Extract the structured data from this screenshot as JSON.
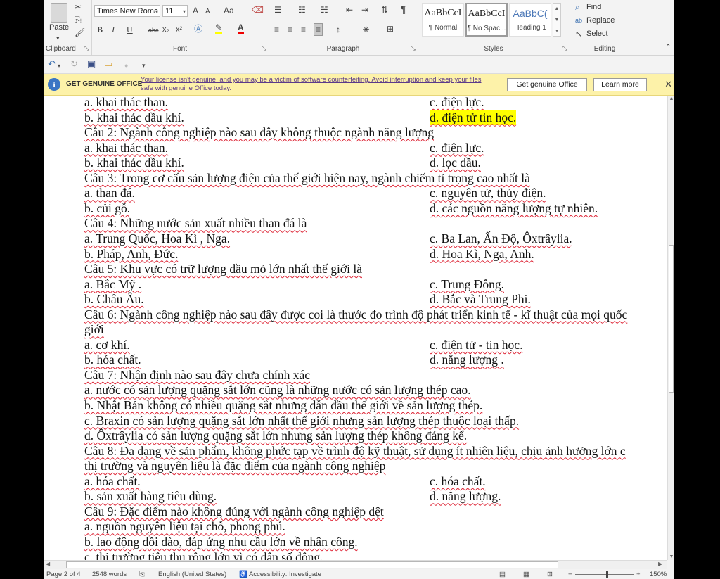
{
  "ribbon": {
    "clipboard": {
      "paste": "Paste",
      "label": "Clipboard"
    },
    "font": {
      "name": "Times New Roma",
      "size": "11",
      "label": "Font",
      "bold": "B",
      "italic": "I",
      "underline": "U",
      "strike": "abc",
      "subscript": "x₂",
      "superscript": "x²",
      "grow": "A",
      "shrink": "A",
      "change_case": "Aa"
    },
    "paragraph": {
      "label": "Paragraph"
    },
    "styles": {
      "label": "Styles",
      "items": [
        {
          "preview": "AaBbCcI",
          "name": "¶ Normal"
        },
        {
          "preview": "AaBbCcI",
          "name": "¶ No Spac..."
        },
        {
          "preview": "AaBbC(",
          "name": "Heading 1"
        }
      ]
    },
    "editing": {
      "find": "Find",
      "replace": "Replace",
      "select": "Select",
      "label": "Editing"
    }
  },
  "message_bar": {
    "title": "GET GENUINE OFFICE",
    "text": "Your license isn't genuine, and you may be a victim of software counterfeiting. Avoid interruption and keep your files safe with genuine Office today.",
    "get_button": "Get genuine Office",
    "learn_button": "Learn more"
  },
  "document": {
    "lines": [
      {
        "text": "a. khai thác than.",
        "ans": "c. điện lực."
      },
      {
        "text": "b. khai thác dầu khí.",
        "ans": "d. điện tử tin học."
      },
      {
        "text": "Câu 2: Ngành công nghiệp nào sau đây không thuộc ngành năng lượng",
        "ans": ""
      },
      {
        "text": "a. khai thác than.",
        "ans": "c. điện lực."
      },
      {
        "text": "b. khai thác dầu khí.",
        "ans": "d. lọc dầu."
      },
      {
        "text": "Câu 3: Trong cơ cấu sản lượng điện của thế giới hiện nay, ngành chiếm tỉ trọng cao nhất là",
        "ans": ""
      },
      {
        "text": "a. than đá.",
        "ans": "c. nguyên tử, thủy điện."
      },
      {
        "text": "b. củi gỗ.",
        "ans": "d. các nguồn năng lượng tự nhiên."
      },
      {
        "text": "Câu 4: Những nước sản xuất nhiều than đá là",
        "ans": ""
      },
      {
        "text": "a. Trung Quốc, Hoa Kì , Nga.",
        "ans": "c. Ba Lan, Ấn Độ, Ôxtrâylia."
      },
      {
        "text": "b. Pháp, Anh, Đức.",
        "ans": "d. Hoa Kì, Nga, Anh."
      },
      {
        "text": "Câu 5: Khu vực có trữ lượng dầu mỏ lớn nhất thế giới là",
        "ans": ""
      },
      {
        "text": "a. Bắc Mỹ .",
        "ans": "c. Trung Đông."
      },
      {
        "text": "b. Châu Âu.",
        "ans": "d. Bắc và Trung Phi."
      },
      {
        "text": "Câu 6: Ngành công nghiệp nào sau đây được coi là thước đo trình độ phát triển kinh tế - kĩ thuật của mọi quốc",
        "ans": ""
      },
      {
        "text": "giới",
        "ans": ""
      },
      {
        "text": "a. cơ khí.",
        "ans": "c. điện tử - tin học."
      },
      {
        "text": "b. hóa chất.",
        "ans": "d. năng lượng ."
      },
      {
        "text": "Câu 7: Nhận định nào sau đây chưa chính xác",
        "ans": ""
      },
      {
        "text": "a. nước có sản lượng quặng sắt lớn cũng là những nước có sản lượng thép cao.",
        "ans": ""
      },
      {
        "text": "b. Nhật Bản không có nhiều quặng sắt nhưng dẫn đầu thế giới về sản lượng thép.",
        "ans": ""
      },
      {
        "text": "c. Braxin có sản lượng quặng sắt lớn nhất thế giới nhưng sản lượng thép thuộc loại thấp.",
        "ans": ""
      },
      {
        "text": "d. Ôxtrâylia có sản lượng quặng sắt lớn nhưng sản lượng thép không đáng kể.",
        "ans": ""
      },
      {
        "text": "Câu 8: Đa dạng về sản phẩm, không phức tạp về trình độ kỹ thuật, sử dụng ít nhiên liệu, chịu ảnh hưởng lớn c",
        "ans": ""
      },
      {
        "text": "thị trường và nguyên liệu là đặc điểm của ngành công nghiệp",
        "ans": ""
      },
      {
        "text": "a. hóa chất.",
        "ans": "c. hóa chất."
      },
      {
        "text": "b. sản xuất hàng tiêu dùng.",
        "ans": "d. năng lượng."
      },
      {
        "text": "Câu 9: Đặc điểm nào không đúng với ngành công nghiệp dệt",
        "ans": ""
      },
      {
        "text": "a. nguồn nguyên liệu tại chỗ, phong phú.",
        "ans": ""
      },
      {
        "text": "b. lao động dồi dào, đáp ứng nhu cầu lớn về nhân công.",
        "ans": ""
      },
      {
        "text": "c. thị trường tiêu thụ rộng lớn vì có dân số đông.",
        "ans": ""
      }
    ]
  },
  "status": {
    "page": "Page 2 of 4",
    "words": "2548 words",
    "language": "English (United States)",
    "accessibility": "Accessibility: Investigate",
    "zoom": "150%"
  }
}
